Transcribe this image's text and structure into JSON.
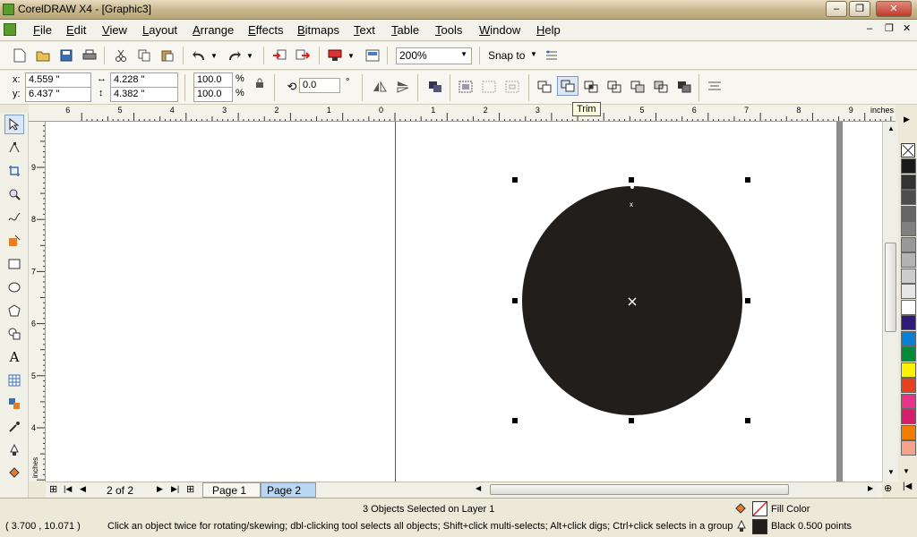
{
  "window": {
    "title": "CorelDRAW X4 - [Graphic3]",
    "min_label": "–",
    "max_label": "❐",
    "close_label": "✕"
  },
  "menu": [
    "File",
    "Edit",
    "View",
    "Layout",
    "Arrange",
    "Effects",
    "Bitmaps",
    "Text",
    "Table",
    "Tools",
    "Window",
    "Help"
  ],
  "standard_toolbar": {
    "zoom_value": "200%",
    "snap_label": "Snap to"
  },
  "property_bar": {
    "x_label": "x:",
    "x_value": "4.559 \"",
    "y_label": "y:",
    "y_value": "6.437 \"",
    "w_value": "4.228 \"",
    "h_value": "4.382 \"",
    "scale_w": "100.0",
    "scale_h": "100.0",
    "percent": "%",
    "rotation": "0.0",
    "degree": "°"
  },
  "tooltip": {
    "text": "Trim"
  },
  "rulers": {
    "unit": "inches",
    "h_ticks": [
      "6",
      "5",
      "4",
      "3",
      "2",
      "1",
      "0",
      "1",
      "2",
      "3",
      "4",
      "5",
      "6",
      "7",
      "8",
      "9"
    ],
    "v_ticks": [
      "9",
      "8",
      "7",
      "6",
      "5",
      "4"
    ],
    "v_unit": "inches"
  },
  "pages": {
    "counter": "2 of 2",
    "tabs": [
      "Page 1",
      "Page 2"
    ],
    "active": "Page 2"
  },
  "status": {
    "selection": "3 Objects Selected on Layer 1",
    "coords": "( 3.700 , 10.071 )",
    "hint": "Click an object twice for rotating/skewing; dbl-clicking tool selects all objects; Shift+click multi-selects; Alt+click digs; Ctrl+click selects in a group",
    "fill_label": "Fill Color",
    "outline_label": "Black  0.500 points"
  },
  "palette_colors": [
    "#1a1a1a",
    "#333333",
    "#4d4d4d",
    "#666666",
    "#808080",
    "#999999",
    "#b3b3b3",
    "#cccccc",
    "#e6e6e6",
    "#ffffff",
    "#2e1a7a",
    "#0b7fd4",
    "#008c3a",
    "#fff200",
    "#e8401c",
    "#e7338a",
    "#d61f6a",
    "#f07c00",
    "#f5a38b"
  ],
  "colors": {
    "circle_fill": "#221e1c",
    "canvas": "#ffffff",
    "workspace": "#ece9d8"
  },
  "icons": [
    "new-icon",
    "open-icon",
    "save-icon",
    "print-icon",
    "cut-icon",
    "copy-icon",
    "paste-icon",
    "undo-icon",
    "redo-icon",
    "import-icon",
    "export-icon",
    "launcher-icon",
    "welcome-icon",
    "lock-icon",
    "rotate-icon",
    "pick-tool-icon",
    "shape-tool-icon",
    "crop-tool-icon",
    "zoom-tool-icon",
    "freehand-tool-icon",
    "smart-fill-icon",
    "rectangle-tool-icon",
    "ellipse-tool-icon",
    "polygon-tool-icon",
    "basic-shapes-icon",
    "text-tool-icon",
    "table-tool-icon",
    "interactive-tool-icon",
    "eyedropper-icon",
    "outline-tool-icon",
    "fill-tool-icon"
  ]
}
